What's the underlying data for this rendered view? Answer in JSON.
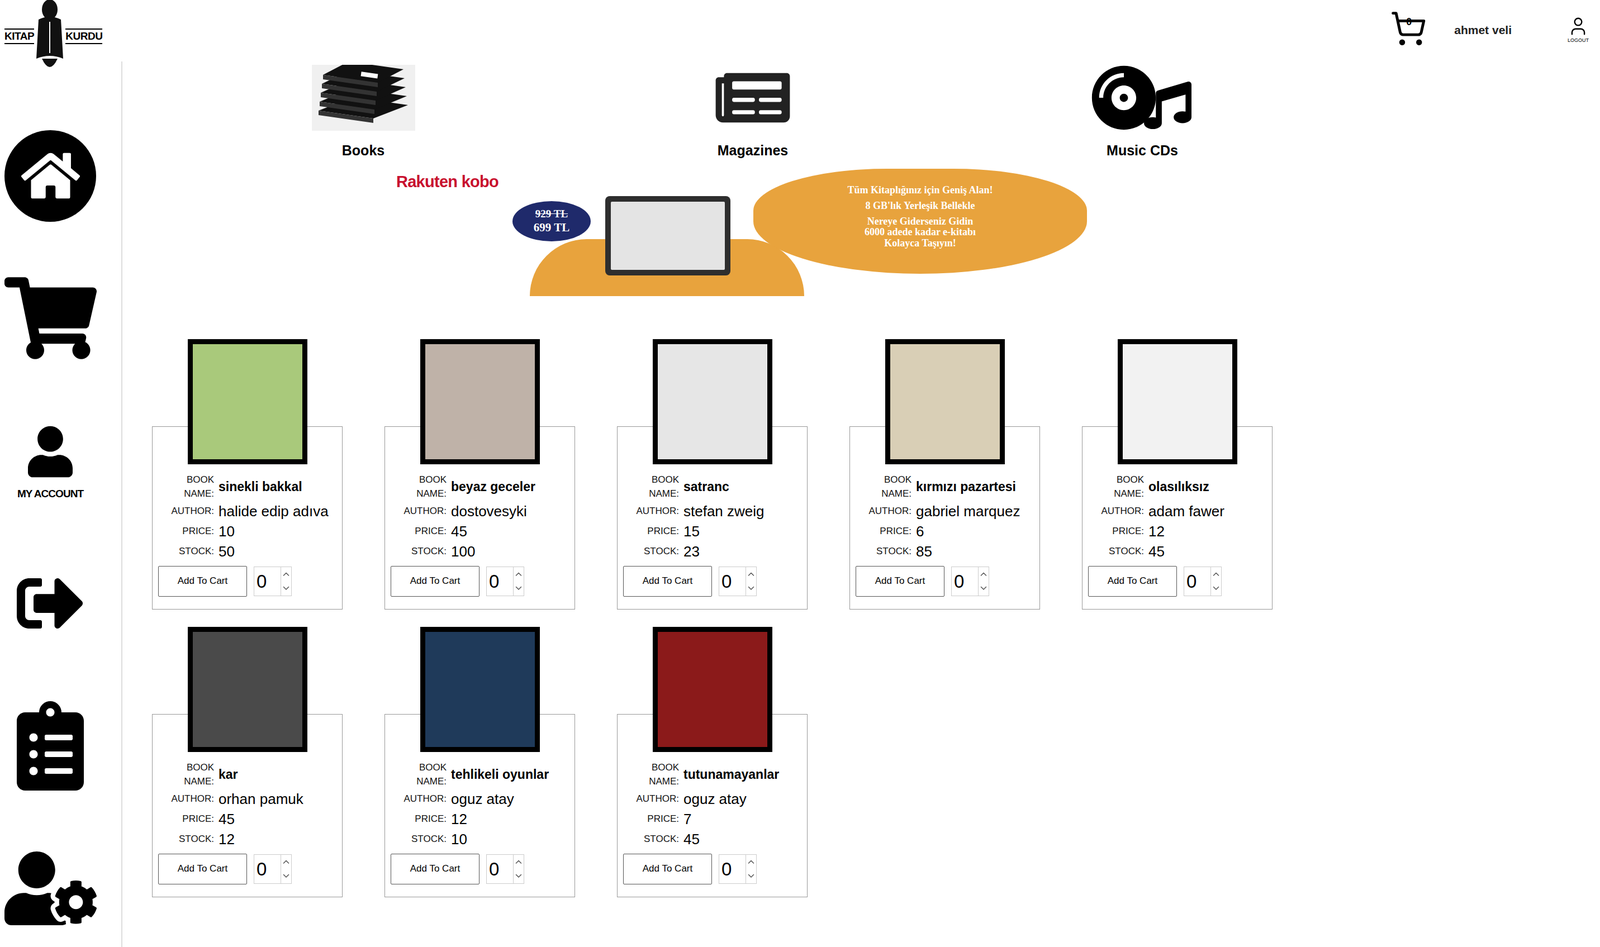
{
  "logo": {
    "left": "KITAP",
    "right": "KURDU"
  },
  "sidebar": {
    "items": [
      {
        "kind": "home",
        "label": ""
      },
      {
        "kind": "cart",
        "label": ""
      },
      {
        "kind": "account",
        "label": "MY ACCOUNT"
      },
      {
        "kind": "logout",
        "label": ""
      },
      {
        "kind": "orders",
        "label": ""
      },
      {
        "kind": "settings",
        "label": ""
      }
    ]
  },
  "header": {
    "cart_count": "0",
    "user": "ahmet veli",
    "logout": "LOGOUT"
  },
  "categories": [
    {
      "label": "Books",
      "kind": "books"
    },
    {
      "label": "Magazines",
      "kind": "magazines"
    },
    {
      "label": "Music CDs",
      "kind": "music"
    }
  ],
  "banner": {
    "brand": "Rakuten kobo",
    "old_price": "929 TL",
    "new_price": "699 TL",
    "lines": [
      "Tüm Kitaplığınız için Geniş Alan!",
      "8 GB'lık Yerleşik Bellekle",
      "Nereye Giderseniz Gidin",
      "6000 adede kadar e-kitabı",
      "Kolayca Taşıyın!"
    ]
  },
  "labels": {
    "name": "BOOK NAME:",
    "author": "AUTHOR:",
    "price": "PRICE:",
    "stock": "STOCK:",
    "button": "Add To Cart"
  },
  "books": [
    {
      "name": "sinekli bakkal",
      "author": "halide edip adıva",
      "price": "10",
      "stock": "50",
      "quantity": "0",
      "color": "#a9c97b"
    },
    {
      "name": "beyaz geceler",
      "author": "dostovesyki",
      "price": "45",
      "stock": "100",
      "quantity": "0",
      "color": "#bfb2a8"
    },
    {
      "name": "satranc",
      "author": "stefan zweig",
      "price": "15",
      "stock": "23",
      "quantity": "0",
      "color": "#e6e6e6"
    },
    {
      "name": "kırmızı pazartesi",
      "author": "gabriel marquez",
      "price": "6",
      "stock": "85",
      "quantity": "0",
      "color": "#d9cfb6"
    },
    {
      "name": "olasılıksız",
      "author": "adam fawer",
      "price": "12",
      "stock": "45",
      "quantity": "0",
      "color": "#f2f2f2"
    },
    {
      "name": "kar",
      "author": "orhan pamuk",
      "price": "45",
      "stock": "12",
      "quantity": "0",
      "color": "#4a4a4a"
    },
    {
      "name": "tehlikeli oyunlar",
      "author": "oguz atay",
      "price": "12",
      "stock": "10",
      "quantity": "0",
      "color": "#1f3a5a"
    },
    {
      "name": "tutunamayanlar",
      "author": "oguz atay",
      "price": "7",
      "stock": "45",
      "quantity": "0",
      "color": "#8b1a1a"
    }
  ]
}
